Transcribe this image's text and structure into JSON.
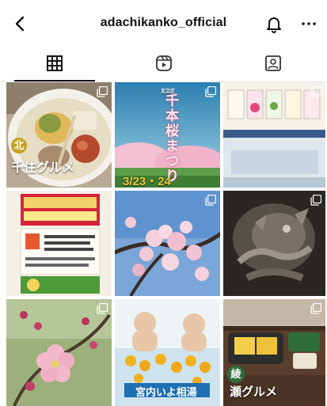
{
  "header": {
    "title": "adachikanko_official",
    "back_icon": "chevron-left-icon",
    "notification_icon": "bell-icon",
    "more_icon": "more-horizontal-icon"
  },
  "tabs": [
    {
      "name": "posts",
      "icon": "grid-icon",
      "selected": true
    },
    {
      "name": "reels",
      "icon": "reels-icon",
      "selected": false
    },
    {
      "name": "tagged",
      "icon": "tagged-user-icon",
      "selected": false
    }
  ],
  "posts": [
    {
      "badge": "北",
      "caption": "千住グルメ",
      "multi": true
    },
    {
      "title_small": "足立区",
      "title": "千本桜まつり",
      "date": "3/23・24",
      "multi": true
    },
    {
      "multi": true
    },
    {
      "text": "ありがとう",
      "multi": false
    },
    {
      "multi": true
    },
    {
      "multi": true
    },
    {
      "multi": true
    },
    {
      "banner": "宮内いよ相湯",
      "multi": false
    },
    {
      "badge": "綾",
      "caption": "瀬グルメ",
      "multi": true
    }
  ],
  "colors": {
    "text": "#111111",
    "badge": "#c5a021",
    "date": "#e8c63a"
  }
}
